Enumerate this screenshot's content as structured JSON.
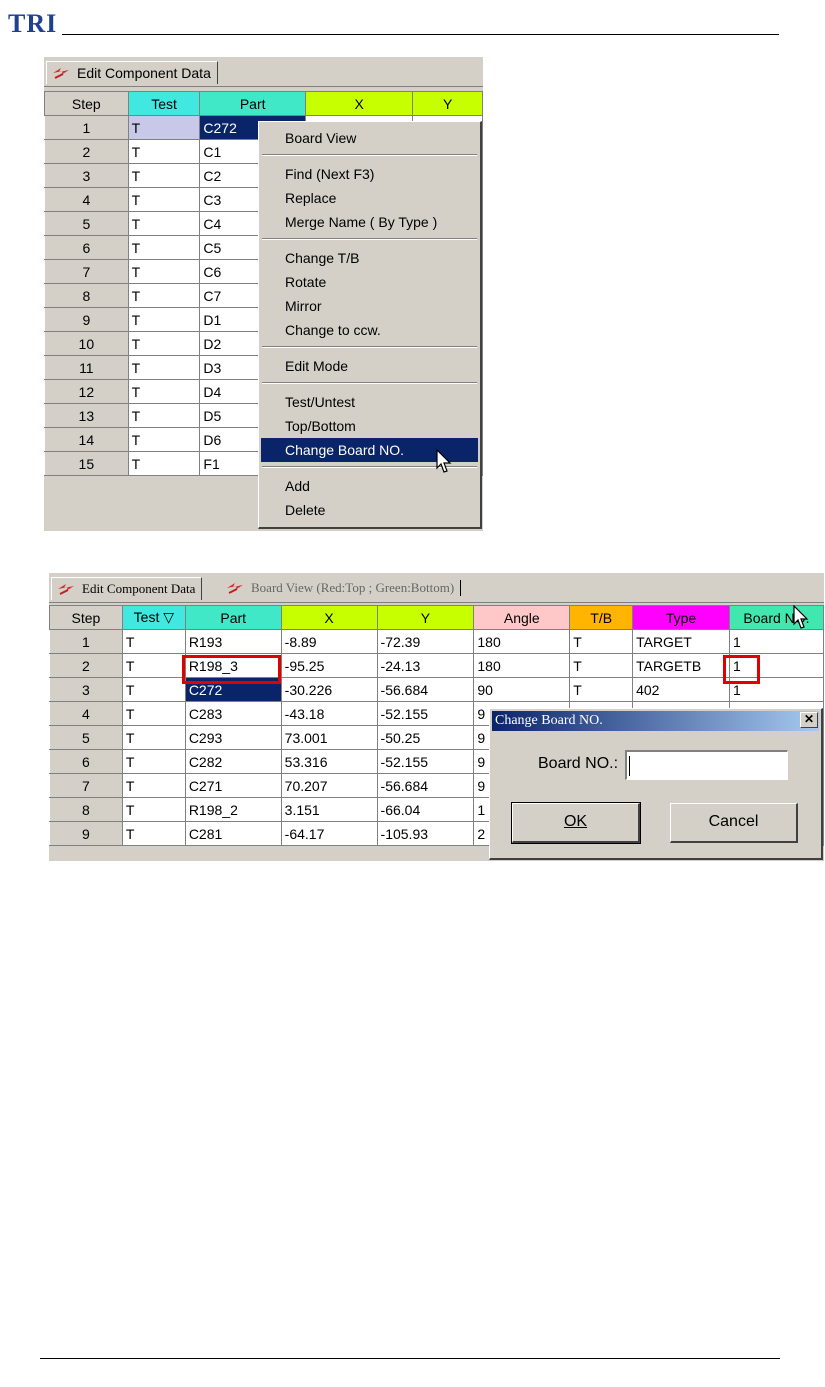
{
  "logo": "TRI",
  "shot1": {
    "tab_label": "Edit Component Data",
    "columns": [
      {
        "label": "Step",
        "color": "#d4d0c8"
      },
      {
        "label": "Test",
        "color": "#40e8e0"
      },
      {
        "label": "Part",
        "color": "#40e8c8"
      },
      {
        "label": "X",
        "color": "#c8ff00"
      },
      {
        "label": "Y",
        "color": "#c8ff00"
      }
    ],
    "rows": [
      {
        "step": "1",
        "test": "T",
        "part": "C272"
      },
      {
        "step": "2",
        "test": "T",
        "part": "C1"
      },
      {
        "step": "3",
        "test": "T",
        "part": "C2"
      },
      {
        "step": "4",
        "test": "T",
        "part": "C3"
      },
      {
        "step": "5",
        "test": "T",
        "part": "C4"
      },
      {
        "step": "6",
        "test": "T",
        "part": "C5"
      },
      {
        "step": "7",
        "test": "T",
        "part": "C6"
      },
      {
        "step": "8",
        "test": "T",
        "part": "C7"
      },
      {
        "step": "9",
        "test": "T",
        "part": "D1"
      },
      {
        "step": "10",
        "test": "T",
        "part": "D2"
      },
      {
        "step": "11",
        "test": "T",
        "part": "D3"
      },
      {
        "step": "12",
        "test": "T",
        "part": "D4"
      },
      {
        "step": "13",
        "test": "T",
        "part": "D5"
      },
      {
        "step": "14",
        "test": "T",
        "part": "D6"
      },
      {
        "step": "15",
        "test": "T",
        "part": "F1"
      }
    ],
    "menu": {
      "items": [
        "Board View",
        "Find (Next  F3)",
        "Replace",
        "Merge Name ( By Type )",
        "Change T/B",
        "Rotate",
        "Mirror",
        "Change to ccw.",
        "Edit Mode",
        "Test/Untest",
        "Top/Bottom",
        "Change Board NO.",
        "Add",
        "Delete"
      ],
      "highlighted": "Change Board NO."
    }
  },
  "shot2": {
    "tab1_label": "Edit Component Data",
    "tab2_label": "Board View (Red:Top ; Green:Bottom)",
    "columns": [
      {
        "label": "Step",
        "color": "#d4d0c8"
      },
      {
        "label": "Test  ▽",
        "color": "#40e8e0"
      },
      {
        "label": "Part",
        "color": "#40e8c8"
      },
      {
        "label": "X",
        "color": "#c8ff00"
      },
      {
        "label": "Y",
        "color": "#c8ff00"
      },
      {
        "label": "Angle",
        "color": "#ffc8c8"
      },
      {
        "label": "T/B",
        "color": "#ffb400"
      },
      {
        "label": "Type",
        "color": "#ff00ff"
      },
      {
        "label": "Board NO.",
        "color": "#40e8b0"
      }
    ],
    "rows": [
      {
        "step": "1",
        "test": "T",
        "part": "R193",
        "x": "-8.89",
        "y": "-72.39",
        "angle": "180",
        "tb": "T",
        "type": "TARGET",
        "board": "1"
      },
      {
        "step": "2",
        "test": "T",
        "part": "R198_3",
        "x": "-95.25",
        "y": "-24.13",
        "angle": "180",
        "tb": "T",
        "type": "TARGETB",
        "board": "1"
      },
      {
        "step": "3",
        "test": "T",
        "part": "C272",
        "x": "-30.226",
        "y": "-56.684",
        "angle": "90",
        "tb": "T",
        "type": "402",
        "board": "1"
      },
      {
        "step": "4",
        "test": "T",
        "part": "C283",
        "x": "-43.18",
        "y": "-52.155",
        "angle": "9",
        "tb": "",
        "type": "",
        "board": ""
      },
      {
        "step": "5",
        "test": "T",
        "part": "C293",
        "x": "73.001",
        "y": "-50.25",
        "angle": "9",
        "tb": "",
        "type": "",
        "board": ""
      },
      {
        "step": "6",
        "test": "T",
        "part": "C282",
        "x": "53.316",
        "y": "-52.155",
        "angle": "9",
        "tb": "",
        "type": "",
        "board": ""
      },
      {
        "step": "7",
        "test": "T",
        "part": "C271",
        "x": "70.207",
        "y": "-56.684",
        "angle": "9",
        "tb": "",
        "type": "",
        "board": ""
      },
      {
        "step": "8",
        "test": "T",
        "part": "R198_2",
        "x": "3.151",
        "y": "-66.04",
        "angle": "1",
        "tb": "",
        "type": "",
        "board": ""
      },
      {
        "step": "9",
        "test": "T",
        "part": "C281",
        "x": "-64.17",
        "y": "-105.93",
        "angle": "2",
        "tb": "",
        "type": "",
        "board": ""
      }
    ],
    "dialog": {
      "title": "Change Board NO.",
      "close_glyph": "✕",
      "field_label": "Board NO.:",
      "field_value": "",
      "ok_label": "OK",
      "cancel_label": "Cancel"
    }
  }
}
